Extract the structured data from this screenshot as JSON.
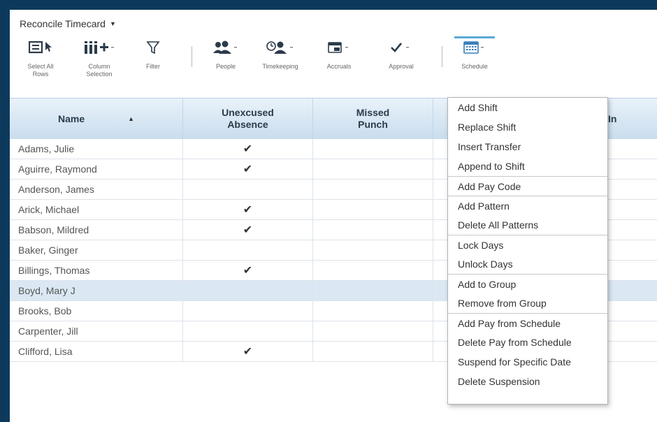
{
  "title": "Reconcile Timecard",
  "toolbar": {
    "select_all": "Select All\nRows",
    "column_selection": "Column\nSelection",
    "filter": "Filter",
    "people": "People",
    "timekeeping": "Timekeeping",
    "accruals": "Accruals",
    "approval": "Approval",
    "schedule": "Schedule"
  },
  "grid": {
    "columns": [
      "Name",
      "Unexcused\nAbsence",
      "Missed\nPunch",
      "",
      "te In"
    ],
    "rows": [
      {
        "name": "Adams, Julie",
        "unexcused": "✔"
      },
      {
        "name": "Aguirre, Raymond",
        "unexcused": "✔"
      },
      {
        "name": "Anderson, James",
        "unexcused": ""
      },
      {
        "name": "Arick, Michael",
        "unexcused": "✔"
      },
      {
        "name": "Babson, Mildred",
        "unexcused": "✔"
      },
      {
        "name": "Baker, Ginger",
        "unexcused": ""
      },
      {
        "name": "Billings, Thomas",
        "unexcused": "✔"
      },
      {
        "name": "Boyd, Mary J",
        "unexcused": ""
      },
      {
        "name": "Brooks, Bob",
        "unexcused": ""
      },
      {
        "name": "Carpenter, Jill",
        "unexcused": ""
      },
      {
        "name": "Clifford, Lisa",
        "unexcused": "✔"
      }
    ],
    "selected_row": "Boyd, Mary J"
  },
  "context_menu": [
    "Add Shift",
    "Replace Shift",
    "Insert Transfer",
    "Append to Shift",
    "Add Pay Code",
    "Add Pattern",
    "Delete All Patterns",
    "Lock Days",
    "Unlock Days",
    "Add to Group",
    "Remove from Group",
    "Add Pay from Schedule",
    "Delete Pay from Schedule",
    "Suspend for Specific Date",
    "Delete Suspension"
  ],
  "colors": {
    "frame": "#0d3a5c",
    "header_gradient_top": "#e9f2fa",
    "header_gradient_bottom": "#c9ddee",
    "selected_row": "#dbe8f4",
    "accent": "#5aa9d6"
  }
}
